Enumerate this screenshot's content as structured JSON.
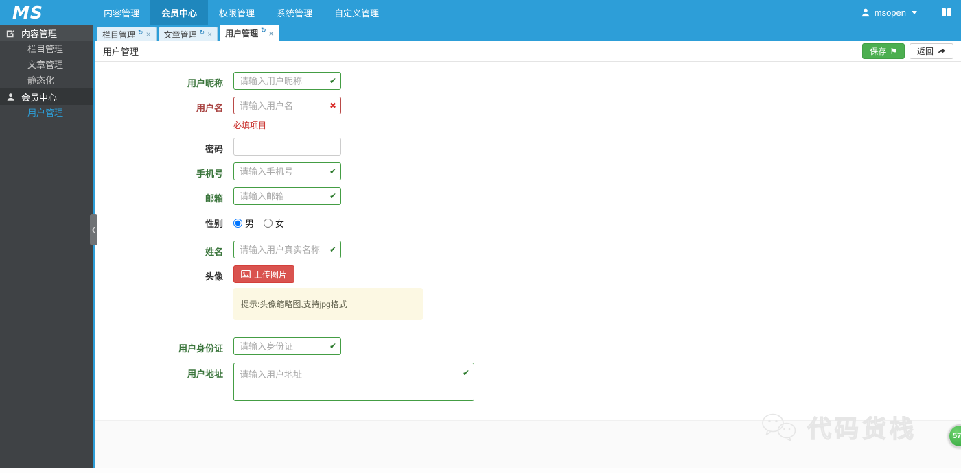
{
  "navbar": {
    "logo": "MS",
    "items": [
      {
        "label": "内容管理"
      },
      {
        "label": "会员中心"
      },
      {
        "label": "权限管理"
      },
      {
        "label": "系统管理"
      },
      {
        "label": "自定义管理"
      }
    ],
    "user_name": "msopen"
  },
  "tabs": [
    {
      "label": "栏目管理"
    },
    {
      "label": "文章管理"
    },
    {
      "label": "用户管理"
    }
  ],
  "sidebar": {
    "sections": [
      {
        "label": "内容管理",
        "icon": "pencil-square",
        "items": [
          {
            "label": "栏目管理"
          },
          {
            "label": "文章管理"
          },
          {
            "label": "静态化"
          }
        ]
      },
      {
        "label": "会员中心",
        "icon": "user",
        "items": [
          {
            "label": "用户管理"
          }
        ]
      }
    ]
  },
  "page": {
    "title": "用户管理",
    "save": "保存",
    "back": "返回"
  },
  "form": {
    "fields": [
      {
        "label": "用户昵称",
        "placeholder": "请输入用户昵称",
        "state": "success"
      },
      {
        "label": "用户名",
        "placeholder": "请输入用户名",
        "state": "error",
        "help": "必填项目"
      },
      {
        "label": "密码",
        "placeholder": "",
        "state": "plain"
      },
      {
        "label": "手机号",
        "placeholder": "请输入手机号",
        "state": "success"
      },
      {
        "label": "邮箱",
        "placeholder": "请输入邮箱",
        "state": "success"
      },
      {
        "label": "性别",
        "options": [
          {
            "label": "男",
            "checked": true
          },
          {
            "label": "女",
            "checked": false
          }
        ]
      },
      {
        "label": "姓名",
        "placeholder": "请输入用户真实名称",
        "state": "success"
      },
      {
        "label": "头像",
        "button": "上传图片",
        "hint": "提示:头像缩略图,支持jpg格式"
      },
      {
        "label": "用户身份证",
        "placeholder": "请输入身份证",
        "state": "success"
      },
      {
        "label": "用户地址",
        "placeholder": "请输入用户地址",
        "state": "success",
        "textarea": true
      }
    ]
  },
  "watermark": {
    "text": "代码货栈"
  },
  "badge": {
    "value": "57"
  },
  "colors": {
    "navbar": "#2d9ed8",
    "nav_active": "#1f87bd",
    "success": "#3c763d",
    "error": "#a94442",
    "save_button": "#4caf50",
    "upload_button": "#d9534f",
    "hint_bg": "#fcf8e3",
    "sidebar_bg": "#3f4245"
  }
}
